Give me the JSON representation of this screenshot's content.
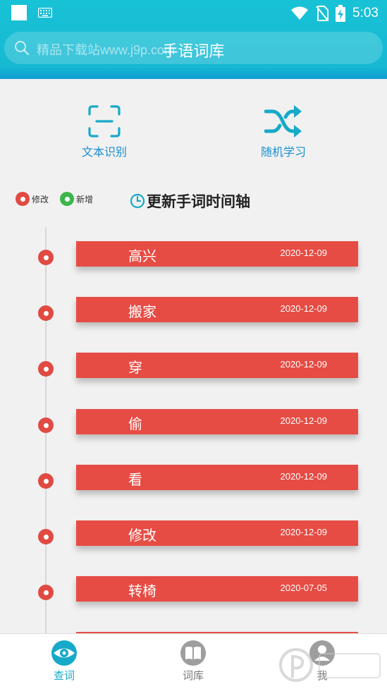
{
  "status_bar": {
    "time": "5:03"
  },
  "header": {
    "title": "手语词库",
    "search_placeholder": "精品下载站www.j9p.com"
  },
  "actions": [
    {
      "label": "文本识别",
      "icon": "scan-icon"
    },
    {
      "label": "随机学习",
      "icon": "shuffle-icon"
    }
  ],
  "legend": {
    "modify": "修改",
    "add": "新增",
    "modify_color": "#e04a42",
    "add_color": "#3cb54a"
  },
  "timeline": {
    "title": "更新手词时间轴",
    "entries": [
      {
        "word": "高兴",
        "date": "2020-12-09"
      },
      {
        "word": "搬家",
        "date": "2020-12-09"
      },
      {
        "word": "穿",
        "date": "2020-12-09"
      },
      {
        "word": "偷",
        "date": "2020-12-09"
      },
      {
        "word": "看",
        "date": "2020-12-09"
      },
      {
        "word": "修改",
        "date": "2020-12-09"
      },
      {
        "word": "转椅",
        "date": "2020-07-05"
      }
    ]
  },
  "nav": [
    {
      "label": "查词",
      "icon": "eye-icon",
      "active": true
    },
    {
      "label": "词库",
      "icon": "book-icon"
    },
    {
      "label": "我",
      "icon": "user-icon"
    }
  ],
  "colors": {
    "accent": "#16b8d2",
    "entry": "#e64c44",
    "link": "#1a8fd0"
  }
}
